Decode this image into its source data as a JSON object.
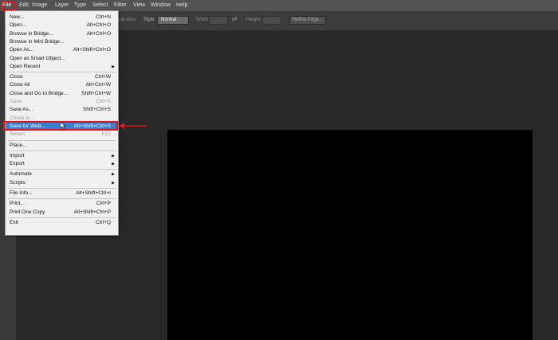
{
  "menubar": {
    "items": [
      "File",
      "Edit",
      "Image",
      "Layer",
      "Type",
      "Select",
      "Filter",
      "View",
      "Window",
      "Help"
    ]
  },
  "options": {
    "antialias": "Anti-alias",
    "style_label": "Style:",
    "style_value": "Normal",
    "width_label": "Width:",
    "height_label": "Height:",
    "refine_edge": "Refine Edge..."
  },
  "file_menu": {
    "items": [
      {
        "label": "New...",
        "shortcut": "Ctrl+N"
      },
      {
        "label": "Open...",
        "shortcut": "Alt+Ctrl+O"
      },
      {
        "label": "Browse in Bridge...",
        "shortcut": "Alt+Ctrl+O"
      },
      {
        "label": "Browse in Mini Bridge...",
        "shortcut": ""
      },
      {
        "label": "Open As...",
        "shortcut": "Alt+Shift+Ctrl+O"
      },
      {
        "label": "Open as Smart Object...",
        "shortcut": ""
      },
      {
        "label": "Open Recent",
        "shortcut": "",
        "submenu": true
      },
      {
        "label": "Close",
        "shortcut": "Ctrl+W"
      },
      {
        "label": "Close All",
        "shortcut": "Alt+Ctrl+W"
      },
      {
        "label": "Close and Go to Bridge...",
        "shortcut": "Shift+Ctrl+W"
      },
      {
        "label": "Save",
        "shortcut": "Ctrl+S",
        "disabled": true
      },
      {
        "label": "Save As...",
        "shortcut": "Shift+Ctrl+S"
      },
      {
        "label": "Check In...",
        "shortcut": "",
        "disabled": true
      },
      {
        "label": "Save for Web...",
        "shortcut": "Alt+Shift+Ctrl+S",
        "highlighted": true
      },
      {
        "label": "Revert",
        "shortcut": "F12",
        "disabled": true
      },
      {
        "label": "Place...",
        "shortcut": ""
      },
      {
        "label": "Import",
        "shortcut": "",
        "submenu": true
      },
      {
        "label": "Export",
        "shortcut": "",
        "submenu": true
      },
      {
        "label": "Automate",
        "shortcut": "",
        "submenu": true
      },
      {
        "label": "Scripts",
        "shortcut": "",
        "submenu": true
      },
      {
        "label": "File Info...",
        "shortcut": "Alt+Shift+Ctrl+I"
      },
      {
        "label": "Print...",
        "shortcut": "Ctrl+P"
      },
      {
        "label": "Print One Copy",
        "shortcut": "Alt+Shift+Ctrl+P"
      },
      {
        "label": "Exit",
        "shortcut": "Ctrl+Q"
      }
    ]
  },
  "colors": {
    "accent_highlight": "#3a7fd0",
    "annotation_red": "#e3121a"
  }
}
